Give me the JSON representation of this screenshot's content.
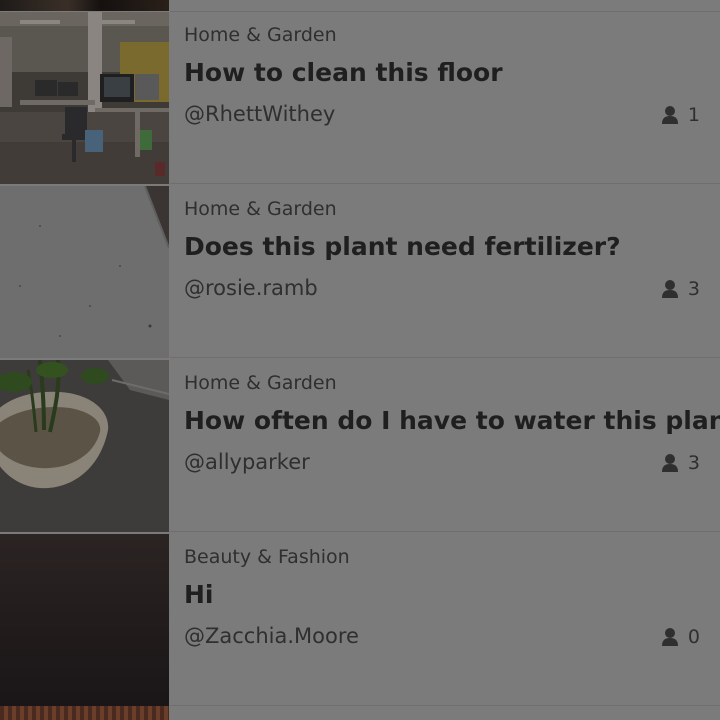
{
  "feed": {
    "items": [
      {
        "thumbnail": "office-floor-photo",
        "category": "Home & Garden",
        "title": "How to clean this floor",
        "author": "@RhettWithey",
        "count": "1",
        "count_icon": "person-icon"
      },
      {
        "thumbnail": "concrete-floor-photo",
        "category": "Home & Garden",
        "title": "Does this plant need fertilizer?",
        "author": "@rosie.ramb",
        "count": "3",
        "count_icon": "person-icon"
      },
      {
        "thumbnail": "potted-plant-photo",
        "category": "Home & Garden",
        "title": "How often do I have to water this plant?",
        "author": "@allyparker",
        "count": "3",
        "count_icon": "person-icon"
      },
      {
        "thumbnail": "dark-wall-photo",
        "category": "Beauty & Fashion",
        "title": "Hi",
        "author": "@Zacchia.Moore",
        "count": "0",
        "count_icon": "person-icon"
      }
    ]
  },
  "colors": {
    "overlay_background": "#7b7b7b",
    "text_primary": "#1f1f1f",
    "text_secondary": "#2f2f2f",
    "divider": "#6e6e6e"
  }
}
